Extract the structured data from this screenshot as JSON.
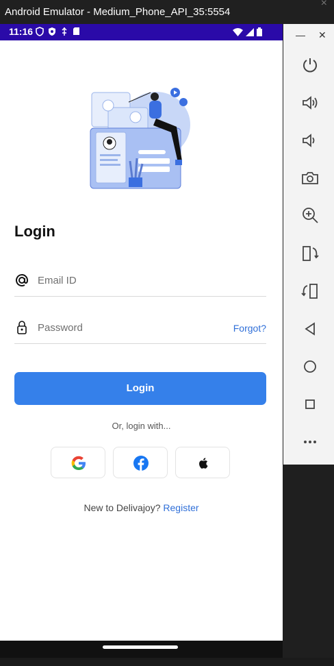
{
  "window": {
    "title": "Android Emulator - Medium_Phone_API_35:5554"
  },
  "statusbar": {
    "time": "11:16"
  },
  "screen": {
    "title": "Login",
    "email_placeholder": "Email ID",
    "password_placeholder": "Password",
    "forgot_label": "Forgot?",
    "login_button": "Login",
    "or_text": "Or, login with...",
    "register_prefix": "New to Delivajoy?",
    "register_link": "Register"
  },
  "social": [
    {
      "name": "google-icon"
    },
    {
      "name": "facebook-icon"
    },
    {
      "name": "apple-icon"
    }
  ],
  "sidepanel": {
    "buttons": [
      "power-icon",
      "volume-up-icon",
      "volume-down-icon",
      "camera-icon",
      "zoom-in-icon",
      "rotate-left-icon",
      "rotate-right-icon",
      "back-icon",
      "home-icon",
      "overview-icon",
      "more-icon"
    ]
  },
  "colors": {
    "status_bar": "#2a0aa8",
    "accent": "#3580ea",
    "link": "#2f6fd8"
  }
}
